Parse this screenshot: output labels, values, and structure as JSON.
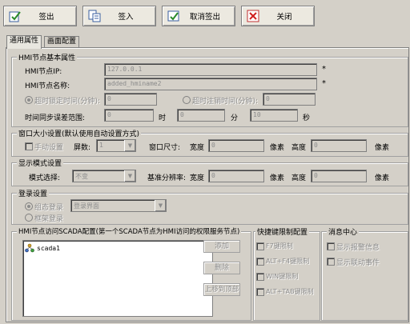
{
  "toolbar": {
    "checkout": "签出",
    "checkin": "签入",
    "cancel_checkout": "取消签出",
    "close": "关闭"
  },
  "tabs": [
    "通用属性",
    "画面配置"
  ],
  "basic": {
    "title": "HMI节点基本属性",
    "ip_label": "HMI节点IP:",
    "ip_value": "127.0.0.1",
    "name_label": "HMI节点名称:",
    "name_value": "added_hminame2",
    "lock_timeout_label": "超时锁定时间(分钟):",
    "lock_timeout_value": "0",
    "logout_timeout_label": "超时注销时间(分钟):",
    "logout_timeout_value": "0",
    "sync_label": "时间同步误差范围:",
    "sync_hour_value": "0",
    "sync_hour_unit": "时",
    "sync_min_value": "0",
    "sync_min_unit": "分",
    "sync_sec_value": "10",
    "sync_sec_unit": "秒",
    "required_mark": "*"
  },
  "window": {
    "title": "窗口大小设置(默认使用自动设置方式)",
    "manual_label": "手动设置",
    "screens_label": "屏数:",
    "screens_value": "1",
    "size_label": "窗口尺寸:",
    "width_label": "宽度",
    "width_value": "0",
    "px_unit": "像素",
    "height_label": "高度",
    "height_value": "0"
  },
  "display": {
    "title": "显示模式设置",
    "mode_label": "模式选择:",
    "mode_value": "不变",
    "res_label": "基准分辨率:",
    "width_label": "宽度",
    "width_value": "0",
    "px_unit": "像素",
    "height_label": "高度",
    "height_value": "0"
  },
  "login": {
    "title": "登录设置",
    "group_login": "组态登录",
    "group_login_value": "登录界面",
    "shelf_login": "框架登录"
  },
  "scada": {
    "title": "HMI节点访问SCADA配置(第一个SCADA节点为HMI访问的权限服务节点)",
    "node": "scada1",
    "add": "添加",
    "delete": "删除",
    "move_top": "上移到顶部"
  },
  "keys": {
    "title": "快捷键限制配置",
    "items": [
      "F7键限制",
      "ALT+F4键限制",
      "WIN键限制",
      "ALT+TAB键限制"
    ]
  },
  "msg": {
    "title": "消息中心",
    "items": [
      "显示报警信息",
      "显示联动事件"
    ]
  }
}
